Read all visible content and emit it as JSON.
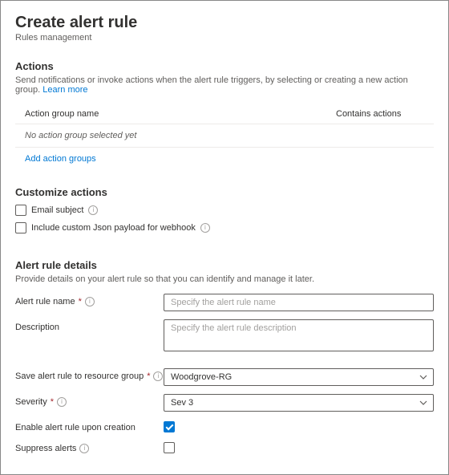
{
  "header": {
    "title": "Create alert rule",
    "subtitle": "Rules management"
  },
  "actions": {
    "heading": "Actions",
    "help": "Send notifications or invoke actions when the alert rule triggers, by selecting or creating a new action group. ",
    "learn_more": "Learn more",
    "col_name": "Action group name",
    "col_contains": "Contains actions",
    "empty_text": "No action group selected yet",
    "add_link": "Add action groups"
  },
  "customize": {
    "heading": "Customize actions",
    "email_subject": "Email subject",
    "webhook_payload": "Include custom Json payload for webhook"
  },
  "details": {
    "heading": "Alert rule details",
    "help": "Provide details on your alert rule so that you can identify and manage it later.",
    "name_label": "Alert rule name",
    "name_placeholder": "Specify the alert rule name",
    "desc_label": "Description",
    "desc_placeholder": "Specify the alert rule description",
    "rg_label": "Save alert rule to resource group",
    "rg_value": "Woodgrove-RG",
    "severity_label": "Severity",
    "severity_value": "Sev 3",
    "enable_label": "Enable alert rule upon creation",
    "suppress_label": "Suppress alerts"
  }
}
